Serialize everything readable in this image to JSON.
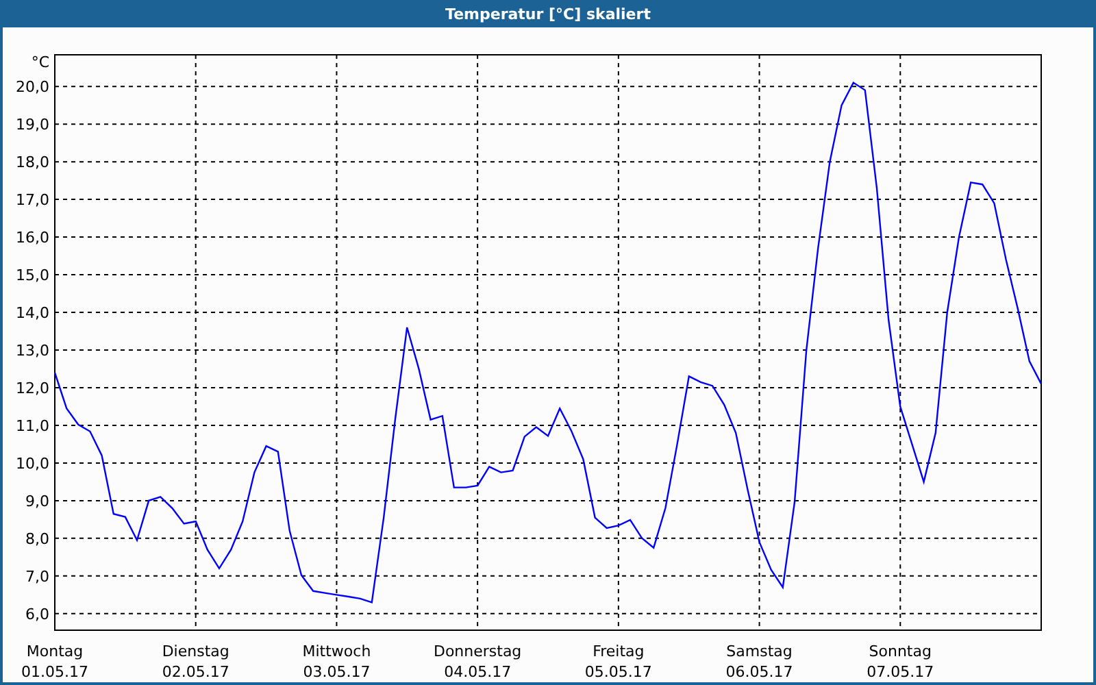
{
  "window": {
    "title": "Temperatur [°C] skaliert"
  },
  "chart_data": {
    "type": "line",
    "grid": true,
    "ylabel": "°C",
    "ylim": [
      5.56,
      20.84
    ],
    "yticks": [
      {
        "value": 6,
        "label": "6,0"
      },
      {
        "value": 7,
        "label": "7,0"
      },
      {
        "value": 8,
        "label": "8,0"
      },
      {
        "value": 9,
        "label": "9,0"
      },
      {
        "value": 10,
        "label": "10,0"
      },
      {
        "value": 11,
        "label": "11,0"
      },
      {
        "value": 12,
        "label": "12,0"
      },
      {
        "value": 13,
        "label": "13,0"
      },
      {
        "value": 14,
        "label": "14,0"
      },
      {
        "value": 15,
        "label": "15,0"
      },
      {
        "value": 16,
        "label": "16,0"
      },
      {
        "value": 17,
        "label": "17,0"
      },
      {
        "value": 18,
        "label": "18,0"
      },
      {
        "value": 19,
        "label": "19,0"
      },
      {
        "value": 20,
        "label": "20,0"
      }
    ],
    "categories": [
      "Montag 01.05.17",
      null,
      null,
      null,
      null,
      null,
      null,
      null,
      null,
      null,
      null,
      null,
      "Dienstag 02.05.17",
      null,
      null,
      null,
      null,
      null,
      null,
      null,
      null,
      null,
      null,
      null,
      "Mittwoch 03.05.17",
      null,
      null,
      null,
      null,
      null,
      null,
      null,
      null,
      null,
      null,
      null,
      "Donnerstag 04.05.17",
      null,
      null,
      null,
      null,
      null,
      null,
      null,
      null,
      null,
      null,
      null,
      "Freitag 05.05.17",
      null,
      null,
      null,
      null,
      null,
      null,
      null,
      null,
      null,
      null,
      null,
      "Samstag 06.05.17",
      null,
      null,
      null,
      null,
      null,
      null,
      null,
      null,
      null,
      null,
      null,
      "Sonntag 07.05.17",
      null,
      null,
      null,
      null,
      null,
      null,
      null,
      null,
      null,
      null,
      null,
      null
    ],
    "values": [
      12.4,
      11.45,
      11.02,
      10.84,
      10.2,
      8.65,
      8.57,
      7.95,
      9.0,
      9.1,
      8.8,
      8.39,
      8.45,
      7.7,
      7.2,
      7.7,
      8.45,
      9.75,
      10.45,
      10.3,
      8.2,
      7.02,
      6.6,
      6.55,
      6.5,
      6.45,
      6.4,
      6.3,
      8.53,
      11.2,
      13.6,
      12.5,
      11.15,
      11.25,
      9.35,
      9.35,
      9.4,
      9.9,
      9.75,
      9.8,
      10.7,
      10.95,
      10.72,
      11.45,
      10.85,
      10.1,
      8.55,
      8.27,
      8.34,
      8.49,
      8.0,
      7.75,
      8.8,
      10.5,
      12.3,
      12.15,
      12.05,
      11.55,
      10.8,
      9.3,
      7.9,
      7.16,
      6.7,
      8.96,
      13.0,
      15.7,
      18.0,
      19.5,
      20.1,
      19.9,
      17.3,
      13.8,
      11.5,
      10.5,
      9.5,
      10.8,
      14.0,
      16.0,
      17.45,
      17.4,
      16.9,
      15.4,
      14.1,
      12.7,
      12.1
    ]
  }
}
